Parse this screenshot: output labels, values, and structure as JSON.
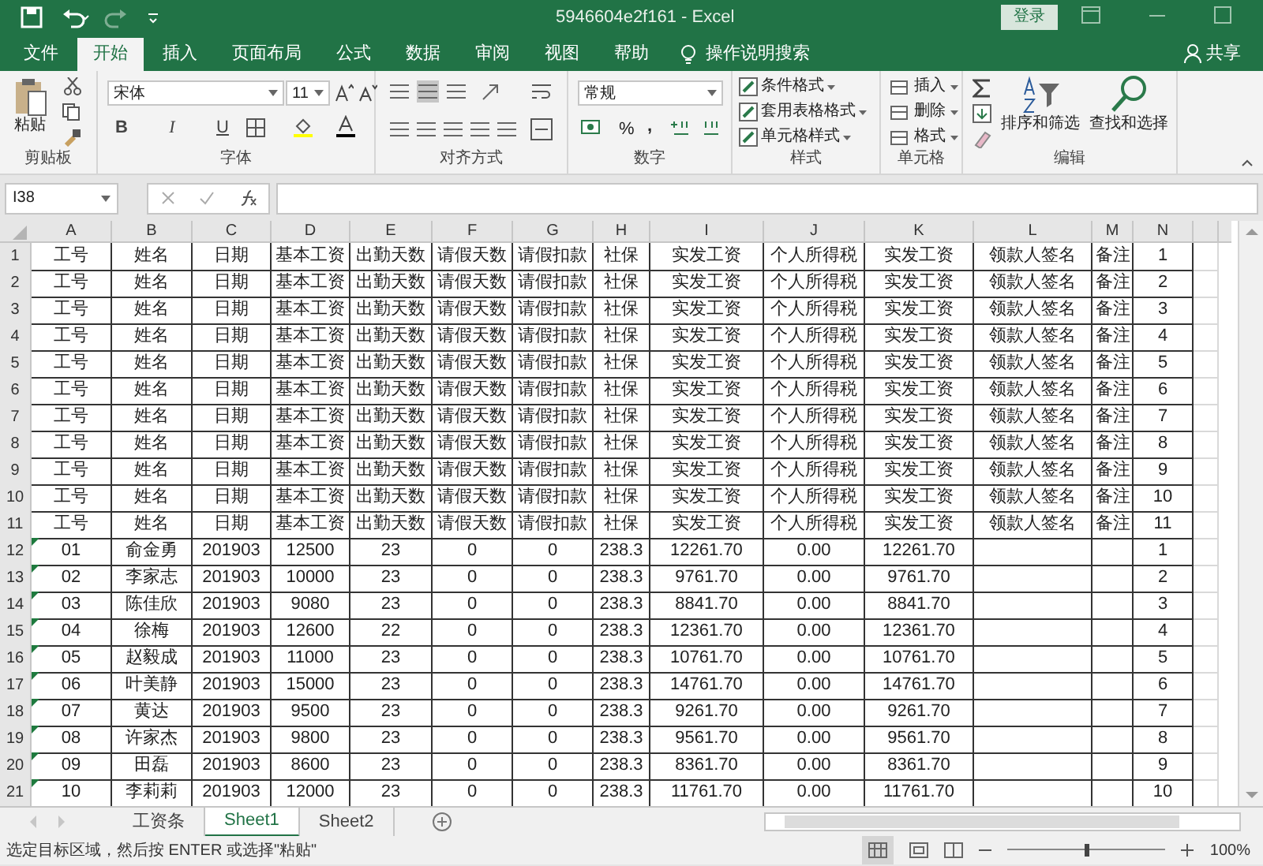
{
  "window": {
    "title": "5946604e2f161  -  Excel",
    "login": "登录"
  },
  "tabs": [
    {
      "label": "文件",
      "selected": false
    },
    {
      "label": "开始",
      "selected": true
    },
    {
      "label": "插入",
      "selected": false
    },
    {
      "label": "页面布局",
      "selected": false
    },
    {
      "label": "公式",
      "selected": false
    },
    {
      "label": "数据",
      "selected": false
    },
    {
      "label": "审阅",
      "selected": false
    },
    {
      "label": "视图",
      "selected": false
    },
    {
      "label": "帮助",
      "selected": false
    }
  ],
  "tell_me": "操作说明搜索",
  "share": "共享",
  "ribbon": {
    "clipboard": {
      "label": "剪贴板",
      "paste": "粘贴"
    },
    "font": {
      "label": "字体",
      "family": "宋体",
      "size": "11",
      "styles": [
        "B",
        "I",
        "U"
      ]
    },
    "alignment": {
      "label": "对齐方式"
    },
    "number": {
      "label": "数字",
      "format": "常规",
      "percent": "%",
      "comma": ","
    },
    "styles": {
      "label": "样式",
      "items": [
        "条件格式",
        "套用表格格式",
        "单元格样式"
      ]
    },
    "cells": {
      "label": "单元格",
      "items": [
        "插入",
        "删除",
        "格式"
      ]
    },
    "editing": {
      "label": "编辑",
      "sort": "排序和筛选",
      "find": "查找和选择"
    }
  },
  "name_box": "I38",
  "columns": [
    "A",
    "B",
    "C",
    "D",
    "E",
    "F",
    "G",
    "H",
    "I",
    "J",
    "K",
    "L",
    "M",
    "N"
  ],
  "rows": [
    {
      "number": "1",
      "text_number_flag": false,
      "cells": [
        "工号",
        "姓名",
        "日期",
        "基本工资",
        "出勤天数",
        "请假天数",
        "请假扣款",
        "社保",
        "实发工资",
        "个人所得税",
        "实发工资",
        "领款人签名",
        "备注",
        "1"
      ]
    },
    {
      "number": "2",
      "text_number_flag": false,
      "cells": [
        "工号",
        "姓名",
        "日期",
        "基本工资",
        "出勤天数",
        "请假天数",
        "请假扣款",
        "社保",
        "实发工资",
        "个人所得税",
        "实发工资",
        "领款人签名",
        "备注",
        "2"
      ]
    },
    {
      "number": "3",
      "text_number_flag": false,
      "cells": [
        "工号",
        "姓名",
        "日期",
        "基本工资",
        "出勤天数",
        "请假天数",
        "请假扣款",
        "社保",
        "实发工资",
        "个人所得税",
        "实发工资",
        "领款人签名",
        "备注",
        "3"
      ]
    },
    {
      "number": "4",
      "text_number_flag": false,
      "cells": [
        "工号",
        "姓名",
        "日期",
        "基本工资",
        "出勤天数",
        "请假天数",
        "请假扣款",
        "社保",
        "实发工资",
        "个人所得税",
        "实发工资",
        "领款人签名",
        "备注",
        "4"
      ]
    },
    {
      "number": "5",
      "text_number_flag": false,
      "cells": [
        "工号",
        "姓名",
        "日期",
        "基本工资",
        "出勤天数",
        "请假天数",
        "请假扣款",
        "社保",
        "实发工资",
        "个人所得税",
        "实发工资",
        "领款人签名",
        "备注",
        "5"
      ]
    },
    {
      "number": "6",
      "text_number_flag": false,
      "cells": [
        "工号",
        "姓名",
        "日期",
        "基本工资",
        "出勤天数",
        "请假天数",
        "请假扣款",
        "社保",
        "实发工资",
        "个人所得税",
        "实发工资",
        "领款人签名",
        "备注",
        "6"
      ]
    },
    {
      "number": "7",
      "text_number_flag": false,
      "cells": [
        "工号",
        "姓名",
        "日期",
        "基本工资",
        "出勤天数",
        "请假天数",
        "请假扣款",
        "社保",
        "实发工资",
        "个人所得税",
        "实发工资",
        "领款人签名",
        "备注",
        "7"
      ]
    },
    {
      "number": "8",
      "text_number_flag": false,
      "cells": [
        "工号",
        "姓名",
        "日期",
        "基本工资",
        "出勤天数",
        "请假天数",
        "请假扣款",
        "社保",
        "实发工资",
        "个人所得税",
        "实发工资",
        "领款人签名",
        "备注",
        "8"
      ]
    },
    {
      "number": "9",
      "text_number_flag": false,
      "cells": [
        "工号",
        "姓名",
        "日期",
        "基本工资",
        "出勤天数",
        "请假天数",
        "请假扣款",
        "社保",
        "实发工资",
        "个人所得税",
        "实发工资",
        "领款人签名",
        "备注",
        "9"
      ]
    },
    {
      "number": "10",
      "text_number_flag": false,
      "cells": [
        "工号",
        "姓名",
        "日期",
        "基本工资",
        "出勤天数",
        "请假天数",
        "请假扣款",
        "社保",
        "实发工资",
        "个人所得税",
        "实发工资",
        "领款人签名",
        "备注",
        "10"
      ]
    },
    {
      "number": "11",
      "text_number_flag": false,
      "cells": [
        "工号",
        "姓名",
        "日期",
        "基本工资",
        "出勤天数",
        "请假天数",
        "请假扣款",
        "社保",
        "实发工资",
        "个人所得税",
        "实发工资",
        "领款人签名",
        "备注",
        "11"
      ]
    },
    {
      "number": "12",
      "text_number_flag": true,
      "cells": [
        "01",
        "俞金勇",
        "201903",
        "12500",
        "23",
        "0",
        "0",
        "238.3",
        "12261.70",
        "0.00",
        "12261.70",
        null,
        null,
        "1"
      ]
    },
    {
      "number": "13",
      "text_number_flag": true,
      "cells": [
        "02",
        "李家志",
        "201903",
        "10000",
        "23",
        "0",
        "0",
        "238.3",
        "9761.70",
        "0.00",
        "9761.70",
        null,
        null,
        "2"
      ]
    },
    {
      "number": "14",
      "text_number_flag": true,
      "cells": [
        "03",
        "陈佳欣",
        "201903",
        "9080",
        "23",
        "0",
        "0",
        "238.3",
        "8841.70",
        "0.00",
        "8841.70",
        null,
        null,
        "3"
      ]
    },
    {
      "number": "15",
      "text_number_flag": true,
      "cells": [
        "04",
        "徐梅",
        "201903",
        "12600",
        "22",
        "0",
        "0",
        "238.3",
        "12361.70",
        "0.00",
        "12361.70",
        null,
        null,
        "4"
      ]
    },
    {
      "number": "16",
      "text_number_flag": true,
      "cells": [
        "05",
        "赵毅成",
        "201903",
        "11000",
        "23",
        "0",
        "0",
        "238.3",
        "10761.70",
        "0.00",
        "10761.70",
        null,
        null,
        "5"
      ]
    },
    {
      "number": "17",
      "text_number_flag": true,
      "cells": [
        "06",
        "叶美静",
        "201903",
        "15000",
        "23",
        "0",
        "0",
        "238.3",
        "14761.70",
        "0.00",
        "14761.70",
        null,
        null,
        "6"
      ]
    },
    {
      "number": "18",
      "text_number_flag": true,
      "cells": [
        "07",
        "黄达",
        "201903",
        "9500",
        "23",
        "0",
        "0",
        "238.3",
        "9261.70",
        "0.00",
        "9261.70",
        null,
        null,
        "7"
      ]
    },
    {
      "number": "19",
      "text_number_flag": true,
      "cells": [
        "08",
        "许家杰",
        "201903",
        "9800",
        "23",
        "0",
        "0",
        "238.3",
        "9561.70",
        "0.00",
        "9561.70",
        null,
        null,
        "8"
      ]
    },
    {
      "number": "20",
      "text_number_flag": true,
      "cells": [
        "09",
        "田磊",
        "201903",
        "8600",
        "23",
        "0",
        "0",
        "238.3",
        "8361.70",
        "0.00",
        "8361.70",
        null,
        null,
        "9"
      ]
    },
    {
      "number": "21",
      "text_number_flag": true,
      "cells": [
        "10",
        "李莉莉",
        "201903",
        "12000",
        "23",
        "0",
        "0",
        "238.3",
        "11761.70",
        "0.00",
        "11761.70",
        null,
        null,
        "10"
      ]
    }
  ],
  "sheets": [
    {
      "label": "工资条",
      "selected": false
    },
    {
      "label": "Sheet1",
      "selected": true
    },
    {
      "label": "Sheet2",
      "selected": false
    }
  ],
  "status": {
    "message": "选定目标区域，然后按 ENTER 或选择\"粘贴\"",
    "zoom": "100%",
    "zoom_slider": {
      "level": 0.5
    }
  }
}
